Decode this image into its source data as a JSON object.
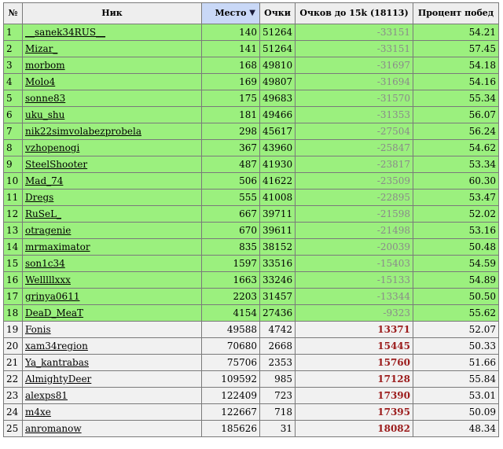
{
  "headers": {
    "index": "№",
    "nick": "Ник",
    "place": "Место",
    "points": "Очки",
    "to15k": "Очков до 15k (18113)",
    "winrate": "Процент побед"
  },
  "sort_arrow": "▼",
  "rows": [
    {
      "n": "1",
      "nick": "__sanek34RUS__",
      "place": "140",
      "points": "51264",
      "to15k": "-33151",
      "win": "54.21",
      "status": "green"
    },
    {
      "n": "2",
      "nick": "Mizar_",
      "place": "141",
      "points": "51264",
      "to15k": "-33151",
      "win": "57.45",
      "status": "green"
    },
    {
      "n": "3",
      "nick": "morbom",
      "place": "168",
      "points": "49810",
      "to15k": "-31697",
      "win": "54.18",
      "status": "green"
    },
    {
      "n": "4",
      "nick": "Molo4",
      "place": "169",
      "points": "49807",
      "to15k": "-31694",
      "win": "54.16",
      "status": "green"
    },
    {
      "n": "5",
      "nick": "sonne83",
      "place": "175",
      "points": "49683",
      "to15k": "-31570",
      "win": "55.34",
      "status": "green"
    },
    {
      "n": "6",
      "nick": "uku_shu",
      "place": "181",
      "points": "49466",
      "to15k": "-31353",
      "win": "56.07",
      "status": "green"
    },
    {
      "n": "7",
      "nick": "nik22simvolabezprobela",
      "place": "298",
      "points": "45617",
      "to15k": "-27504",
      "win": "56.24",
      "status": "green"
    },
    {
      "n": "8",
      "nick": "vzhopenogi",
      "place": "367",
      "points": "43960",
      "to15k": "-25847",
      "win": "54.62",
      "status": "green"
    },
    {
      "n": "9",
      "nick": "SteelShooter",
      "place": "487",
      "points": "41930",
      "to15k": "-23817",
      "win": "53.34",
      "status": "green"
    },
    {
      "n": "10",
      "nick": "Mad_74",
      "place": "506",
      "points": "41622",
      "to15k": "-23509",
      "win": "60.30",
      "status": "green"
    },
    {
      "n": "11",
      "nick": "Dregs",
      "place": "555",
      "points": "41008",
      "to15k": "-22895",
      "win": "53.47",
      "status": "green"
    },
    {
      "n": "12",
      "nick": "RuSeL_",
      "place": "667",
      "points": "39711",
      "to15k": "-21598",
      "win": "52.02",
      "status": "green"
    },
    {
      "n": "13",
      "nick": "otragenie",
      "place": "670",
      "points": "39611",
      "to15k": "-21498",
      "win": "53.16",
      "status": "green"
    },
    {
      "n": "14",
      "nick": "mrmaximator",
      "place": "835",
      "points": "38152",
      "to15k": "-20039",
      "win": "50.48",
      "status": "green"
    },
    {
      "n": "15",
      "nick": "son1c34",
      "place": "1597",
      "points": "33516",
      "to15k": "-15403",
      "win": "54.59",
      "status": "green"
    },
    {
      "n": "16",
      "nick": "Welllllxxx",
      "place": "1663",
      "points": "33246",
      "to15k": "-15133",
      "win": "54.89",
      "status": "green"
    },
    {
      "n": "17",
      "nick": "grinya0611",
      "place": "2203",
      "points": "31457",
      "to15k": "-13344",
      "win": "50.50",
      "status": "green"
    },
    {
      "n": "18",
      "nick": "DeaD_MeaT",
      "place": "4154",
      "points": "27436",
      "to15k": "-9323",
      "win": "55.62",
      "status": "green"
    },
    {
      "n": "19",
      "nick": "Fonis",
      "place": "49588",
      "points": "4742",
      "to15k": "13371",
      "win": "52.07",
      "status": "gray"
    },
    {
      "n": "20",
      "nick": "xam34region",
      "place": "70680",
      "points": "2668",
      "to15k": "15445",
      "win": "50.33",
      "status": "gray"
    },
    {
      "n": "21",
      "nick": "Ya_kantrabas",
      "place": "75706",
      "points": "2353",
      "to15k": "15760",
      "win": "51.66",
      "status": "gray"
    },
    {
      "n": "22",
      "nick": "AlmightyDeer",
      "place": "109592",
      "points": "985",
      "to15k": "17128",
      "win": "55.84",
      "status": "gray"
    },
    {
      "n": "23",
      "nick": "alexps81",
      "place": "122409",
      "points": "723",
      "to15k": "17390",
      "win": "53.01",
      "status": "gray"
    },
    {
      "n": "24",
      "nick": "m4xe",
      "place": "122667",
      "points": "718",
      "to15k": "17395",
      "win": "50.09",
      "status": "gray"
    },
    {
      "n": "25",
      "nick": "anromanow",
      "place": "185626",
      "points": "31",
      "to15k": "18082",
      "win": "48.34",
      "status": "gray"
    }
  ],
  "colors": {
    "qualified_row": "#9bf07e",
    "unqualified_row": "#f1f1f1",
    "sorted_header": "#c9d8f7",
    "negative_value": "#8a8a8a",
    "positive_value": "#9b1b1b"
  }
}
